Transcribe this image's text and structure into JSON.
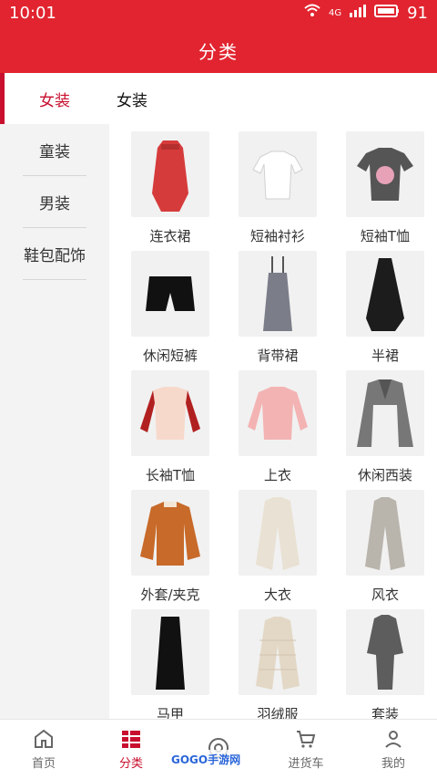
{
  "status": {
    "time": "10:01",
    "network": "4G",
    "battery": "91"
  },
  "header": {
    "title": "分类"
  },
  "sidebar": {
    "items": [
      {
        "label": "女装",
        "active": true
      },
      {
        "label": "童装"
      },
      {
        "label": "男装"
      },
      {
        "label": "鞋包配饰"
      }
    ]
  },
  "content": {
    "title": "女装",
    "products": [
      {
        "label": "连衣裙",
        "icon": "dress-icon"
      },
      {
        "label": "短袖衬衫",
        "icon": "blouse-icon"
      },
      {
        "label": "短袖T恤",
        "icon": "tshirt-icon"
      },
      {
        "label": "休闲短裤",
        "icon": "shorts-icon"
      },
      {
        "label": "背带裙",
        "icon": "overall-dress-icon"
      },
      {
        "label": "半裙",
        "icon": "skirt-icon"
      },
      {
        "label": "长袖T恤",
        "icon": "longsleeve-icon"
      },
      {
        "label": "上衣",
        "icon": "sweater-icon"
      },
      {
        "label": "休闲西装",
        "icon": "blazer-icon"
      },
      {
        "label": "外套/夹克",
        "icon": "jacket-icon"
      },
      {
        "label": "大衣",
        "icon": "coat-icon"
      },
      {
        "label": "风衣",
        "icon": "trenchcoat-icon"
      },
      {
        "label": "马甲",
        "icon": "vest-icon"
      },
      {
        "label": "羽绒服",
        "icon": "down-jacket-icon"
      },
      {
        "label": "套装",
        "icon": "suit-icon"
      }
    ]
  },
  "tabbar": {
    "items": [
      {
        "label": "首页",
        "icon": "home-icon"
      },
      {
        "label": "分类",
        "icon": "category-icon",
        "active": true
      },
      {
        "label": "",
        "icon": "target-icon"
      },
      {
        "label": "进货车",
        "icon": "cart-icon"
      },
      {
        "label": "我的",
        "icon": "user-icon"
      }
    ]
  },
  "watermark": {
    "text": "GOGO手游网"
  },
  "colors": {
    "accent": "#e1242f",
    "active_text": "#c8102e"
  }
}
